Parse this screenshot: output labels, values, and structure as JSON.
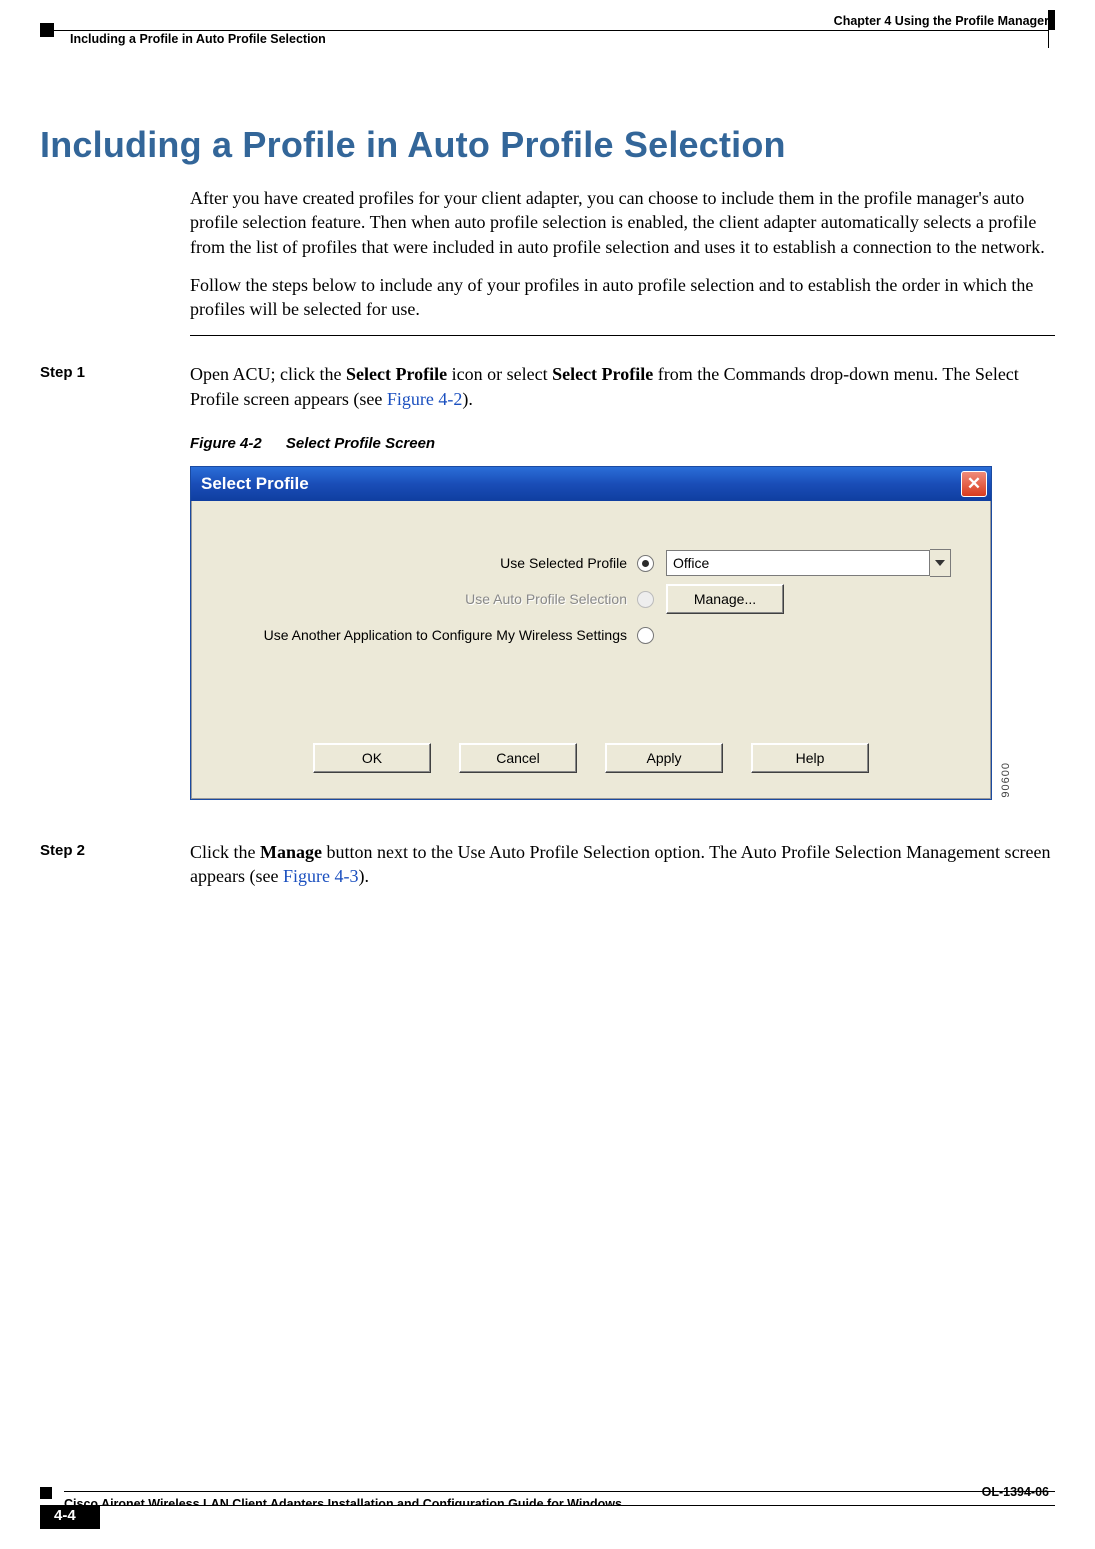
{
  "header": {
    "chapter": "Chapter 4      Using the Profile Manager",
    "section": "Including a Profile in Auto Profile Selection"
  },
  "title": "Including a Profile in Auto Profile Selection",
  "intro": {
    "p1": "After you have created profiles for your client adapter, you can choose to include them in the profile manager's auto profile selection feature. Then when auto profile selection is enabled, the client adapter automatically selects a profile from the list of profiles that were included in auto profile selection and uses it to establish a connection to the network.",
    "p2": "Follow the steps below to include any of your profiles in auto profile selection and to establish the order in which the profiles will be selected for use."
  },
  "steps": {
    "s1": {
      "label": "Step 1",
      "text_a": "Open ACU; click the ",
      "bold_a": "Select Profile",
      "text_b": " icon or select ",
      "bold_b": "Select Profile",
      "text_c": " from the Commands drop-down menu. The Select Profile screen appears (see ",
      "xref": "Figure 4-2",
      "text_d": ")."
    },
    "s2": {
      "label": "Step 2",
      "text_a": "Click the ",
      "bold_a": "Manage",
      "text_b": " button next to the Use Auto Profile Selection option. The Auto Profile Selection Management screen appears (see ",
      "xref": "Figure 4-3",
      "text_c": ")."
    }
  },
  "figure": {
    "num": "Figure 4-2",
    "title": "Select Profile Screen",
    "image_id": "90600"
  },
  "dialog": {
    "title": "Select Profile",
    "close_glyph": "✕",
    "opt1_label": "Use Selected Profile",
    "opt1_value": "Office",
    "opt2_label": "Use Auto Profile Selection",
    "opt2_button": "Manage...",
    "opt3_label": "Use Another Application to Configure My Wireless Settings",
    "buttons": {
      "ok": "OK",
      "cancel": "Cancel",
      "apply": "Apply",
      "help": "Help"
    }
  },
  "footer": {
    "book": "Cisco Aironet Wireless LAN Client Adapters Installation and Configuration Guide for Windows",
    "page": "4-4",
    "docnum": "OL-1394-06"
  }
}
